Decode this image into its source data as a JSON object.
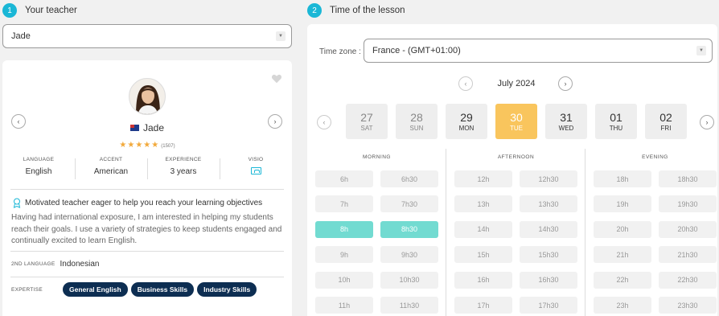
{
  "steps": [
    {
      "num": "1",
      "label": "Your teacher"
    },
    {
      "num": "2",
      "label": "Time of the lesson"
    }
  ],
  "teacher_select": {
    "value": "Jade",
    "caret": "▼"
  },
  "teacher": {
    "name": "Jade",
    "rating_stars": "★★★★★",
    "rating_value": 5,
    "review_count": "(1507)",
    "stats": [
      {
        "label": "LANGUAGE",
        "value": "English"
      },
      {
        "label": "ACCENT",
        "value": "American"
      },
      {
        "label": "EXPERIENCE",
        "value": "3 years"
      },
      {
        "label": "VISIO",
        "value": "",
        "icon": "video-icon"
      }
    ],
    "headline": "Motivated teacher eager to help you reach your learning objectives",
    "bio": "Having had international exposure, I am interested in helping my students reach their goals. I use a variety of strategies to keep students engaged and continually excited to learn English.",
    "second_language_label": "2ND LANGUAGE",
    "second_language": "Indonesian",
    "expertise_label": "EXPERTISE",
    "expertise": [
      "General English",
      "Business Skills",
      "Industry Skills"
    ],
    "prev_icon": "‹",
    "next_icon": "›"
  },
  "time": {
    "tz_label": "Time zone :",
    "tz_value": "France - (GMT+01:00)",
    "month": "July 2024",
    "nav_prev": "‹",
    "nav_next": "›",
    "days": [
      {
        "num": "27",
        "wd": "SAT",
        "state": "past"
      },
      {
        "num": "28",
        "wd": "SUN",
        "state": "past"
      },
      {
        "num": "29",
        "wd": "MON",
        "state": "normal"
      },
      {
        "num": "30",
        "wd": "TUE",
        "state": "selected"
      },
      {
        "num": "31",
        "wd": "WED",
        "state": "normal"
      },
      {
        "num": "01",
        "wd": "THU",
        "state": "normal"
      },
      {
        "num": "02",
        "wd": "FRI",
        "state": "normal"
      }
    ],
    "periods": [
      {
        "label": "MORNING",
        "slots": [
          "6h",
          "6h30",
          "7h",
          "7h30",
          "8h",
          "8h30",
          "9h",
          "9h30",
          "10h",
          "10h30",
          "11h",
          "11h30"
        ]
      },
      {
        "label": "AFTERNOON",
        "slots": [
          "12h",
          "12h30",
          "13h",
          "13h30",
          "14h",
          "14h30",
          "15h",
          "15h30",
          "16h",
          "16h30",
          "17h",
          "17h30"
        ]
      },
      {
        "label": "EVENING",
        "slots": [
          "18h",
          "18h30",
          "19h",
          "19h30",
          "20h",
          "20h30",
          "21h",
          "21h30",
          "22h",
          "22h30",
          "23h",
          "23h30"
        ]
      }
    ],
    "selected_slots": [
      "8h",
      "8h30"
    ]
  },
  "colors": {
    "accent": "#1ab7d6",
    "selected_day": "#f9c55d",
    "selected_slot": "#72dbd1",
    "tag_bg": "#0d2e52",
    "star": "#f2a93b"
  }
}
